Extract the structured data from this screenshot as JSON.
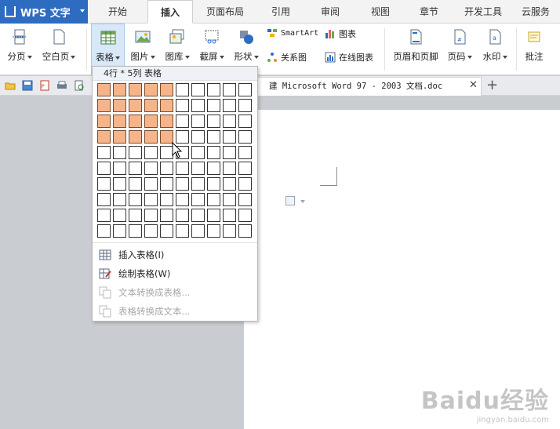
{
  "app": {
    "title": "WPS 文字"
  },
  "tabs": [
    "开始",
    "插入",
    "页面布局",
    "引用",
    "审阅",
    "视图",
    "章节",
    "开发工具",
    "云服务"
  ],
  "active_tab": "插入",
  "ribbon": {
    "page_break": "分页",
    "blank_page": "空白页",
    "table": "表格",
    "picture": "图片",
    "gallery": "图库",
    "screenshot": "截屏",
    "shapes": "形状",
    "smartart": "SmartArt",
    "chart": "图表",
    "relation_chart": "关系图",
    "online_chart": "在线图表",
    "header_footer": "页眉和页脚",
    "page_number": "页码",
    "watermark": "水印",
    "comment": "批注"
  },
  "document_tab": {
    "title": "建 Microsoft Word 97 - 2003 文档.doc"
  },
  "table_dropdown": {
    "header": "4行 * 5列 表格",
    "rows": 10,
    "cols": 10,
    "selected_rows": 4,
    "selected_cols": 5,
    "items": [
      {
        "label": "插入表格(I)",
        "enabled": true,
        "icon": "insert-table-icon"
      },
      {
        "label": "绘制表格(W)",
        "enabled": true,
        "icon": "draw-table-icon"
      },
      {
        "label": "文本转换成表格...",
        "enabled": false,
        "icon": "text-to-table-icon"
      },
      {
        "label": "表格转换成文本...",
        "enabled": false,
        "icon": "table-to-text-icon"
      }
    ]
  },
  "watermark": {
    "brand": "Baidu经验",
    "url": "jingyan.baidu.com"
  },
  "colors": {
    "accent": "#2d6cc0",
    "grid_selected": "#f5b489"
  }
}
